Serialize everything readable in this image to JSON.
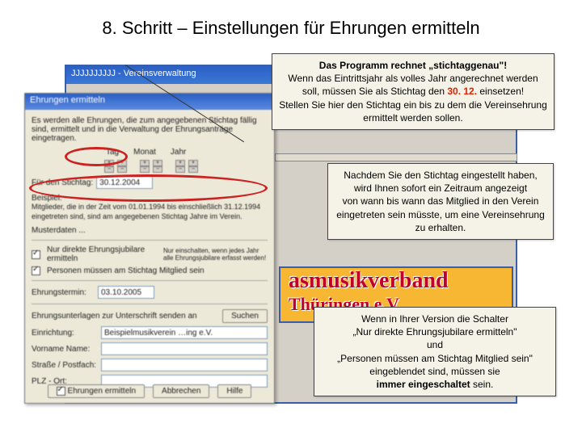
{
  "title": "8. Schritt – Einstellungen für Ehrungen ermitteln",
  "app": {
    "titlebar": "JJJJJJJJJJ - Vereinsverwaltung"
  },
  "dialog": {
    "titlebar": "Ehrungen ermitteln",
    "intro": "Es werden alle Ehrungen, die zum angegebenen Stichtag fällig sind, ermittelt und in die Verwaltung der Ehrungsanträge eingetragen.",
    "labels": {
      "tag": "Tag",
      "monat": "Monat",
      "jahr": "Jahr",
      "stichtag": "Für den Stichtag:",
      "beispiel": "Beispiel:",
      "beispiel_text": "Mitglieder, die in der Zeit vom 01.01.1994 bis einschließlich 31.12.1994 eingetreten sind, sind am angegebenen Stichtag Jahre im Verein.",
      "musterdaten": "Musterdaten ...",
      "chk1": "Nur direkte Ehrungsjubilare ermitteln",
      "chk1_hint": "Nur einschalten, wenn jedes Jahr alle Ehrungsjubilare erfasst werden!",
      "chk2": "Personen müssen am Stichtag Mitglied sein",
      "ehrungstermin": "Ehrungstermin:",
      "unterlagen": "Ehrungsunterlagen zur Unterschrift senden an",
      "suchen": "Suchen",
      "einrichtung": "Einrichtung:",
      "vorname": "Vorname Name:",
      "strasse": "Straße / Postfach:",
      "plz": "PLZ - Ort:",
      "ermitteln": "Ehrungen ermitteln",
      "abbrechen": "Abbrechen",
      "hilfe": "Hilfe"
    },
    "values": {
      "stichtag": "30.12.2004",
      "ehrungstermin": "03.10.2005",
      "einrichtung": "Beispielmusikverein …ing e.V."
    }
  },
  "callouts": {
    "c1a": "Das Programm rechnet „stichtaggenau\"!",
    "c1b": "Wenn das Eintrittsjahr als volles Jahr angerechnet werden soll, müssen Sie als Stichtag den ",
    "c1c": "30. 12.",
    "c1d": " einsetzen!",
    "c1e": "Stellen Sie hier den Stichtag ein bis zu dem die Vereinsehrung ermittelt werden sollen.",
    "c2a": "Nachdem Sie den Stichtag eingestellt haben, wird Ihnen sofort ein Zeitraum angezeigt",
    "c2b": "von wann bis wann das Mitglied in den Verein eingetreten sein müsste, um eine Vereinsehrung zu erhalten.",
    "c3a": "Wenn in Ihrer Version die Schalter",
    "c3b": "„Nur direkte Ehrungsjubilare ermitteln\"",
    "c3c": "und",
    "c3d": "„Personen müssen am Stichtag Mitglied sein\"",
    "c3e": "eingeblendet sind, müssen sie",
    "c3f": "immer eingeschaltet",
    "c3g": " sein."
  },
  "logo": {
    "line1": "asmusikverband",
    "line2": "Thüringen e.V"
  }
}
